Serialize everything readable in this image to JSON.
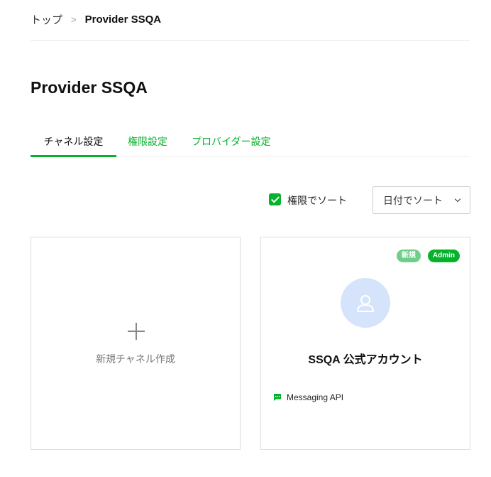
{
  "breadcrumb": {
    "home": "トップ",
    "separator": ">",
    "current": "Provider SSQA"
  },
  "page": {
    "title": "Provider SSQA"
  },
  "tabs": [
    {
      "label": "チャネル設定",
      "active": true
    },
    {
      "label": "権限設定",
      "active": false
    },
    {
      "label": "プロバイダー設定",
      "active": false
    }
  ],
  "sort": {
    "checkbox_label": "権限でソート",
    "checkbox_checked": true,
    "select_value": "日付でソート"
  },
  "new_channel_card": {
    "label": "新規チャネル作成",
    "icon": "plus-icon"
  },
  "channels": [
    {
      "name": "SSQA 公式アカウント",
      "badges": [
        "新規",
        "Admin"
      ],
      "type": "Messaging API",
      "type_icon": "chat-bubble-icon",
      "avatar_icon": "user-icon"
    }
  ],
  "colors": {
    "accent": "#06b22c",
    "badge_new": "#6fcf8a",
    "avatar_bg": "#d6e4fb"
  }
}
